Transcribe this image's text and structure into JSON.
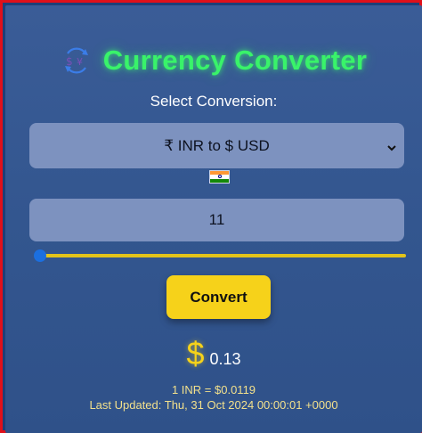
{
  "header": {
    "title": "Currency Converter",
    "icon": "currency-exchange-icon"
  },
  "conversion": {
    "label": "Select Conversion:",
    "selected": "₹ INR to $ USD",
    "flag": "india-flag-icon"
  },
  "amount": {
    "value": "11"
  },
  "slider": {
    "value_fraction": 0.0
  },
  "actions": {
    "convert_label": "Convert"
  },
  "result": {
    "symbol": "$",
    "value": "0.13",
    "rate": "1 INR = $0.0119",
    "last_updated": "Last Updated: Thu, 31 Oct 2024 00:00:01 +0000"
  },
  "colors": {
    "title": "#39f36a",
    "accent": "#f6d21a",
    "slider_thumb": "#1b6fe0",
    "background": "#33568f"
  }
}
